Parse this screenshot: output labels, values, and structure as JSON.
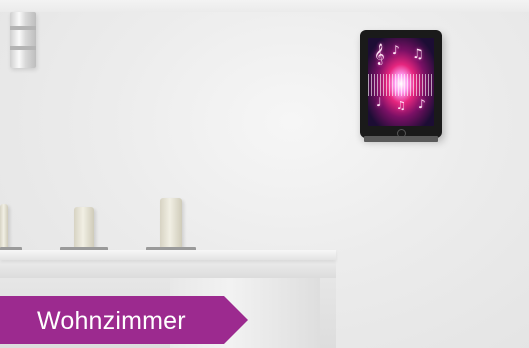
{
  "banner": {
    "label": "Wohnzimmer",
    "background_color": "#9c2a8f",
    "text_color": "#ffffff"
  },
  "scene": {
    "wall_color": "#ececec",
    "tablet_screen_notes": [
      "♪",
      "♫",
      "𝄞",
      "♩",
      "♫",
      "♪"
    ],
    "icons": [
      "wall-light-icon",
      "tablet-icon",
      "candle-icon"
    ]
  }
}
